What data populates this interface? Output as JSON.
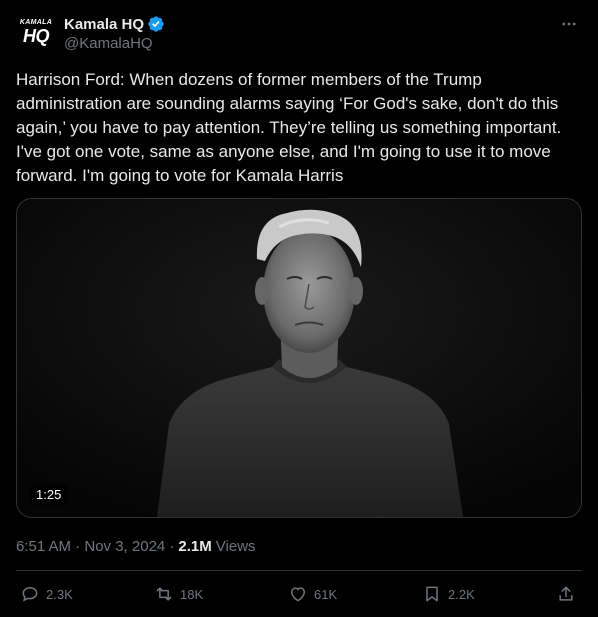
{
  "post": {
    "avatar": {
      "line1": "KAMALA",
      "line2": "HQ"
    },
    "display_name": "Kamala HQ",
    "handle": "@KamalaHQ",
    "text": "Harrison Ford: When dozens of former members of the Trump administration are sounding alarms saying ‘For God's sake, don't do this again,’ you have to pay attention. They’re telling us something important. I've got one vote, same as anyone else, and I'm going to use it to move forward. I'm going to vote for Kamala Harris",
    "video_duration": "1:25",
    "timestamp": "6:51 AM · Nov 3, 2024 ·",
    "views_count": "2.1M",
    "views_label": "Views"
  },
  "actions": {
    "replies": "2.3K",
    "reposts": "18K",
    "likes": "61K",
    "bookmarks": "2.2K"
  },
  "icons": [
    "verified-badge-icon",
    "more-icon",
    "reply-icon",
    "repost-icon",
    "like-icon",
    "bookmark-icon",
    "share-icon"
  ],
  "colors": {
    "background": "#000000",
    "text": "#e7e9ea",
    "muted": "#71767b",
    "verified": "#1d9bf0",
    "border": "#2f3336"
  }
}
